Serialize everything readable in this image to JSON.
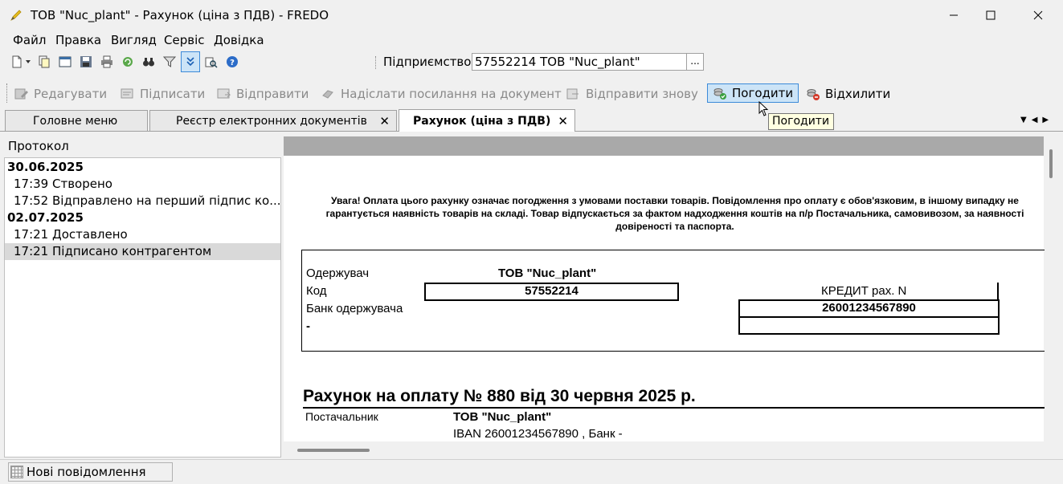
{
  "window": {
    "title": "ТОВ \"Nuc_plant\" - Рахунок (ціна з ПДВ) - FREDO"
  },
  "menu": [
    "Файл",
    "Правка",
    "Вигляд",
    "Сервіс",
    "Довідка"
  ],
  "org": {
    "label": "Підприємство",
    "value": "57552214  ТОВ \"Nuc_plant\"",
    "browse_label": "..."
  },
  "actions": {
    "edit": "Редагувати",
    "sign": "Підписати",
    "send": "Відправити",
    "send_link": "Надіслати посилання на документ",
    "resend": "Відправити знову",
    "approve": "Погодити",
    "reject": "Відхилити"
  },
  "tooltip": "Погодити",
  "tabs": [
    {
      "label": "Головне меню",
      "closable": false
    },
    {
      "label": "Реєстр електронних документів",
      "closable": true
    },
    {
      "label": "Рахунок (ціна з ПДВ)",
      "closable": true,
      "active": true
    }
  ],
  "close_glyph": "✕",
  "protocol": {
    "header": "Протокол",
    "rows": [
      {
        "type": "date",
        "text": "30.06.2025"
      },
      {
        "type": "event",
        "text": "17:39  Створено"
      },
      {
        "type": "event",
        "text": "17:52  Відправлено на перший підпис ко..."
      },
      {
        "type": "date",
        "text": "02.07.2025"
      },
      {
        "type": "event",
        "text": "17:21  Доставлено"
      },
      {
        "type": "event",
        "text": "17:21  Підписано контрагентом",
        "selected": true
      }
    ]
  },
  "document": {
    "warning": "Увага! Оплата цього рахунку означає погодження з умовами поставки товарів. Повідомлення про оплату є обов'язковим, в іншому випадку не гарантується наявність товарів на складі. Товар відпускається за фактом надходження коштів на п/р Постачальника, самовивозом, за наявності довіреності та паспорта.",
    "recipient_label": "Одержувач",
    "recipient_name": "ТОВ \"Nuc_plant\"",
    "code_label": "Код",
    "code_value": "57552214",
    "bank_label": "Банк одержувача",
    "bank_value": "-",
    "credit_label": "КРЕДИТ рах. N",
    "credit_value": "26001234567890",
    "invoice_title": "Рахунок на оплату № 880 від 30 червня 2025 р.",
    "supplier_label": "Постачальник",
    "supplier_name": "ТОВ \"Nuc_plant\"",
    "supplier_iban": "IBAN 26001234567890 , Банк -"
  },
  "status": {
    "messages": "Нові повідомлення"
  },
  "colors": {
    "approve_bg": "#cce4f7",
    "approve_border": "#3c8ad8",
    "disabled_text": "#8a8a8a",
    "doc_topbar": "#a9a9a9",
    "tooltip_bg": "#ffffe1"
  },
  "icons": {
    "app": "pencil-icon",
    "minimize": "minimize-icon",
    "maximize": "maximize-icon",
    "close": "close-icon"
  }
}
